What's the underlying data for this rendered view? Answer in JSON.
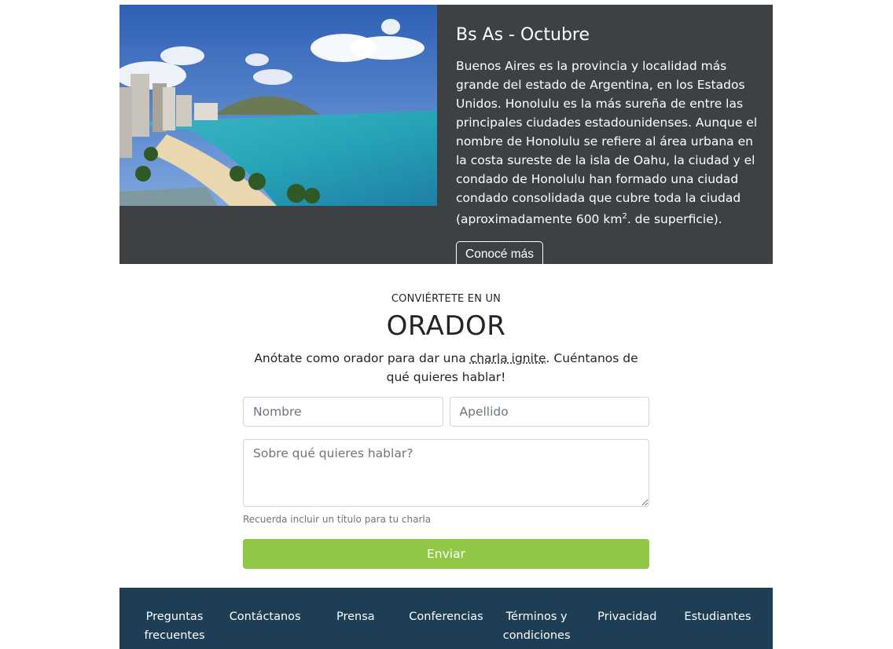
{
  "hero": {
    "image_alt_icon": "beach-city-photo",
    "title": "Bs As - Octubre",
    "text_main": "Buenos Aires es la provincia y localidad más grande del estado de Argentina, en los Estados Unidos. Honolulu es la más sureña de entre las principales ciudades estadounidenses. Aunque el nombre de Honolulu se refiere al área urbana en la costa sureste de la isla de Oahu, la ciudad y el condado de Honolulu han formado una ciudad condado consolidada que cubre toda la ciudad (aproximadamente 600 km",
    "text_sup": "2",
    "text_tail": ". de superficie).",
    "button_label": "Conocé más"
  },
  "speaker": {
    "kicker": "CONVIÉRTETE EN UN",
    "title": "ORADOR",
    "lead_before": "Anótate como orador para dar una ",
    "lead_link": "charla ignite",
    "lead_after": ". Cuéntanos de qué quieres hablar!"
  },
  "form": {
    "first_name_placeholder": "Nombre",
    "last_name_placeholder": "Apellido",
    "topic_placeholder": "Sobre qué quieres hablar?",
    "help_text": "Recuerda incluir un título para tu charla",
    "submit_label": "Enviar"
  },
  "footer": {
    "links": [
      "Preguntas frecuentes",
      "Contáctanos",
      "Prensa",
      "Conferencias",
      "Términos y condiciones",
      "Privacidad",
      "Estudiantes"
    ]
  },
  "colors": {
    "hero_bg": "#3d4144",
    "submit_bg": "#90c744",
    "footer_bg": "#1d3e55"
  }
}
